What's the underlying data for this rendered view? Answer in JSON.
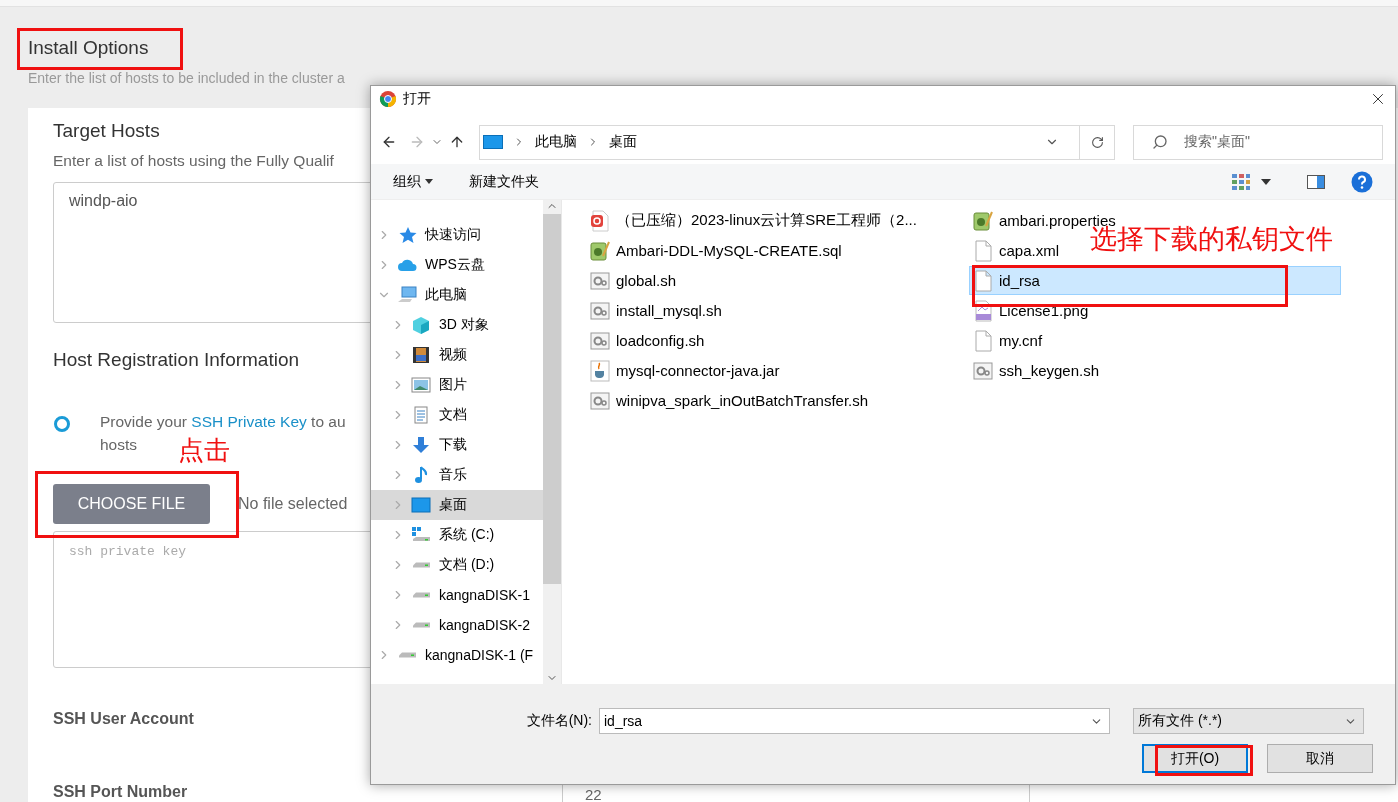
{
  "page": {
    "title": "Install Options",
    "subtitle": "Enter the list of hosts to be included in the cluster a",
    "target_hosts": {
      "heading": "Target Hosts",
      "hint": "Enter a list of hosts using the Fully Qualif",
      "value": "windp-aio"
    },
    "registration": {
      "heading": "Host Registration Information",
      "option": {
        "selected": true,
        "before": "Provide your ",
        "link": "SSH Private Key",
        "after": " to au",
        "line2": "hosts"
      },
      "choose_button": "CHOOSE FILE",
      "file_status": "No file selected",
      "key_placeholder": "ssh private key"
    },
    "ssh_user_label": "SSH User Account",
    "ssh_port_label": "SSH Port Number",
    "ssh_port_value": "22"
  },
  "annotations": [
    {
      "kind": "box"
    },
    {
      "kind": "box"
    },
    {
      "kind": "box"
    },
    {
      "kind": "box"
    },
    {
      "kind": "label",
      "text": "点击"
    },
    {
      "kind": "label",
      "text": "选择下载的私钥文件"
    }
  ],
  "dialog": {
    "title": "打开",
    "path": [
      "此电脑",
      "桌面"
    ],
    "search_placeholder": "搜索\"桌面\"",
    "toolbar": {
      "organize": "组织",
      "new_folder": "新建文件夹"
    },
    "nav": [
      {
        "kind": "star",
        "label": "快速访问",
        "expanded": false,
        "selected": false
      },
      {
        "kind": "cloud",
        "label": "WPS云盘",
        "expanded": false,
        "selected": false
      },
      {
        "kind": "pc",
        "label": "此电脑",
        "expanded": true,
        "selected": false,
        "children": [
          {
            "kind": "cube",
            "label": "3D 对象",
            "expanded": false,
            "selected": false
          },
          {
            "kind": "film",
            "label": "视频",
            "expanded": false,
            "selected": false
          },
          {
            "kind": "image",
            "label": "图片",
            "expanded": false,
            "selected": false
          },
          {
            "kind": "doc",
            "label": "文档",
            "expanded": false,
            "selected": false
          },
          {
            "kind": "download",
            "label": "下载",
            "expanded": false,
            "selected": false
          },
          {
            "kind": "music",
            "label": "音乐",
            "expanded": false,
            "selected": false
          },
          {
            "kind": "desktop",
            "label": "桌面",
            "expanded": false,
            "selected": true
          },
          {
            "kind": "windrive",
            "label": "系统 (C:)",
            "expanded": false,
            "selected": false
          },
          {
            "kind": "drive",
            "label": "文档 (D:)",
            "expanded": false,
            "selected": false
          },
          {
            "kind": "drive",
            "label": "kangnaDISK-1",
            "expanded": false,
            "selected": false
          },
          {
            "kind": "drive",
            "label": "kangnaDISK-2",
            "expanded": false,
            "selected": false
          }
        ]
      },
      {
        "kind": "drive",
        "label": "kangnaDISK-1 (F",
        "expanded": false,
        "selected": false
      }
    ],
    "files": [
      {
        "kind": "pdf",
        "name": "（已压缩）2023-linux云计算SRE工程师（2...",
        "selected": false
      },
      {
        "kind": "notepad",
        "name": "Ambari-DDL-MySQL-CREATE.sql",
        "selected": false
      },
      {
        "kind": "script",
        "name": "global.sh",
        "selected": false
      },
      {
        "kind": "script",
        "name": "install_mysql.sh",
        "selected": false
      },
      {
        "kind": "script",
        "name": "loadconfig.sh",
        "selected": false
      },
      {
        "kind": "java",
        "name": "mysql-connector-java.jar",
        "selected": false
      },
      {
        "kind": "script",
        "name": "winipva_spark_inOutBatchTransfer.sh",
        "selected": false
      },
      {
        "kind": "notepad",
        "name": "ambari.properties",
        "selected": false
      },
      {
        "kind": "blank",
        "name": "capa.xml",
        "selected": false
      },
      {
        "kind": "blank",
        "name": "id_rsa",
        "selected": true
      },
      {
        "kind": "png",
        "name": "License1.png",
        "selected": false
      },
      {
        "kind": "blank",
        "name": "my.cnf",
        "selected": false
      },
      {
        "kind": "script",
        "name": "ssh_keygen.sh",
        "selected": false
      }
    ],
    "filename_label": "文件名(N):",
    "filename": "id_rsa",
    "filetype": "所有文件 (*.*)",
    "buttons": [
      {
        "label": "打开(O)",
        "default": true
      },
      {
        "label": "取消",
        "default": false
      }
    ]
  }
}
